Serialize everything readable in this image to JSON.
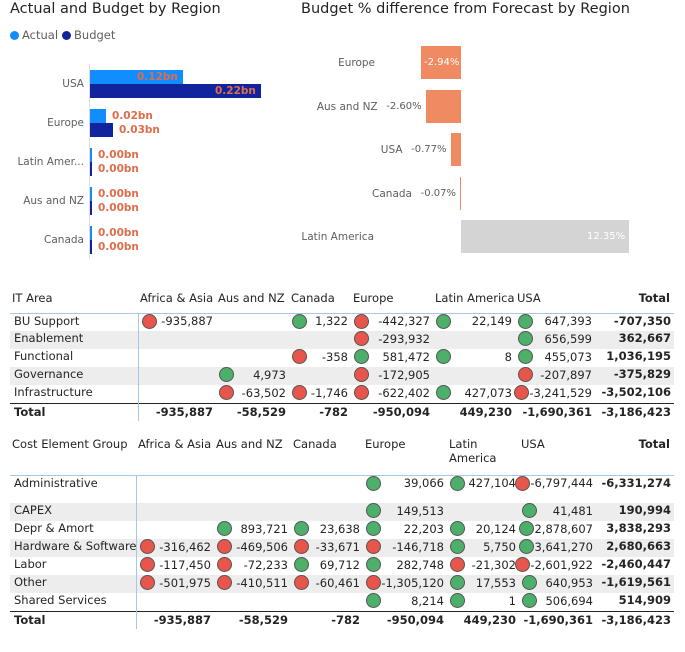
{
  "left_chart": {
    "title": "Actual and Budget by Region",
    "legend": [
      {
        "label": "Actual",
        "color": "#118dff"
      },
      {
        "label": "Budget",
        "color": "#12239e"
      }
    ],
    "chart_data": {
      "type": "bar",
      "orientation": "horizontal",
      "categories": [
        "USA",
        "Europe",
        "Latin Amer...",
        "Aus and NZ",
        "Canada"
      ],
      "series": [
        {
          "name": "Actual",
          "values": [
            0.12,
            0.02,
            0.0,
            0.0,
            0.0
          ],
          "labels": [
            "0.12bn",
            "0.02bn",
            "0.00bn",
            "0.00bn",
            "0.00bn"
          ]
        },
        {
          "name": "Budget",
          "values": [
            0.22,
            0.03,
            0.0,
            0.0,
            0.0
          ],
          "labels": [
            "0.22bn",
            "0.03bn",
            "0.00bn",
            "0.00bn",
            "0.00bn"
          ]
        }
      ],
      "unit": "bn",
      "xlim": [
        0,
        0.22
      ]
    }
  },
  "right_chart": {
    "title": "Budget % difference from Forecast by Region",
    "chart_data": {
      "type": "bar",
      "orientation": "horizontal",
      "categories": [
        "Europe",
        "Aus and NZ",
        "USA",
        "Canada",
        "Latin America"
      ],
      "values": [
        -2.94,
        -2.6,
        -0.77,
        -0.07,
        12.35
      ],
      "labels": [
        "-2.94%",
        "-2.60%",
        "-0.77%",
        "-0.07%",
        "12.35%"
      ],
      "colors": {
        "negative": "#ef8a62",
        "positive": "#d4d4d4",
        "inside_label": "#ffffff",
        "outside_label": "#605e5c"
      }
    }
  },
  "it_table": {
    "headers": [
      "IT Area",
      "Africa & Asia",
      "Aus and NZ",
      "Canada",
      "Europe",
      "Latin America",
      "USA",
      "Total"
    ],
    "rows": [
      {
        "label": "BU Support",
        "cells": [
          [
            "r",
            "-935,887"
          ],
          [
            "",
            ""
          ],
          [
            "g",
            "1,322"
          ],
          [
            "r",
            "-442,327"
          ],
          [
            "g",
            "22,149"
          ],
          [
            "g",
            "647,393"
          ]
        ],
        "total": "-707,350"
      },
      {
        "label": "Enablement",
        "cells": [
          [
            "",
            ""
          ],
          [
            "",
            ""
          ],
          [
            "",
            ""
          ],
          [
            "r",
            "-293,932"
          ],
          [
            "",
            ""
          ],
          [
            "g",
            "656,599"
          ]
        ],
        "total": "362,667"
      },
      {
        "label": "Functional",
        "cells": [
          [
            "",
            ""
          ],
          [
            "",
            ""
          ],
          [
            "r",
            "-358"
          ],
          [
            "g",
            "581,472"
          ],
          [
            "g",
            "8"
          ],
          [
            "g",
            "455,073"
          ]
        ],
        "total": "1,036,195"
      },
      {
        "label": "Governance",
        "cells": [
          [
            "",
            ""
          ],
          [
            "g",
            "4,973"
          ],
          [
            "",
            ""
          ],
          [
            "r",
            "-172,905"
          ],
          [
            "",
            ""
          ],
          [
            "r",
            "-207,897"
          ]
        ],
        "total": "-375,829"
      },
      {
        "label": "Infrastructure",
        "cells": [
          [
            "",
            ""
          ],
          [
            "r",
            "-63,502"
          ],
          [
            "r",
            "-1,746"
          ],
          [
            "r",
            "-622,402"
          ],
          [
            "g",
            "427,073"
          ],
          [
            "r",
            "-3,241,529"
          ]
        ],
        "total": "-3,502,106"
      }
    ],
    "total_row": {
      "label": "Total",
      "values": [
        "-935,887",
        "-58,529",
        "-782",
        "-950,094",
        "449,230",
        "-1,690,361"
      ],
      "total": "-3,186,423"
    }
  },
  "cost_table": {
    "headers": [
      "Cost Element Group",
      "Africa & Asia",
      "Aus and NZ",
      "Canada",
      "Europe",
      "Latin America",
      "USA",
      "Total"
    ],
    "rows": [
      {
        "label": "Administrative",
        "cells": [
          [
            "",
            ""
          ],
          [
            "",
            ""
          ],
          [
            "",
            ""
          ],
          [
            "g",
            "39,066"
          ],
          [
            "g",
            "427,104"
          ],
          [
            "r",
            "-6,797,444"
          ]
        ],
        "total": "-6,331,274"
      },
      {
        "label": "CAPEX",
        "cells": [
          [
            "",
            ""
          ],
          [
            "",
            ""
          ],
          [
            "",
            ""
          ],
          [
            "g",
            "149,513"
          ],
          [
            "",
            ""
          ],
          [
            "g",
            "41,481"
          ]
        ],
        "total": "190,994"
      },
      {
        "label": "Depr & Amort",
        "cells": [
          [
            "",
            ""
          ],
          [
            "g",
            "893,721"
          ],
          [
            "g",
            "23,638"
          ],
          [
            "g",
            "22,203"
          ],
          [
            "g",
            "20,124"
          ],
          [
            "g",
            "2,878,607"
          ]
        ],
        "total": "3,838,293"
      },
      {
        "label": "Hardware & Software",
        "cells": [
          [
            "r",
            "-316,462"
          ],
          [
            "r",
            "-469,506"
          ],
          [
            "r",
            "-33,671"
          ],
          [
            "r",
            "-146,718"
          ],
          [
            "g",
            "5,750"
          ],
          [
            "g",
            "3,641,270"
          ]
        ],
        "total": "2,680,663"
      },
      {
        "label": "Labor",
        "cells": [
          [
            "r",
            "-117,450"
          ],
          [
            "r",
            "-72,233"
          ],
          [
            "g",
            "69,712"
          ],
          [
            "g",
            "282,748"
          ],
          [
            "r",
            "-21,302"
          ],
          [
            "r",
            "-2,601,922"
          ]
        ],
        "total": "-2,460,447"
      },
      {
        "label": "Other",
        "cells": [
          [
            "r",
            "-501,975"
          ],
          [
            "r",
            "-410,511"
          ],
          [
            "r",
            "-60,461"
          ],
          [
            "r",
            "-1,305,120"
          ],
          [
            "g",
            "17,553"
          ],
          [
            "g",
            "640,953"
          ]
        ],
        "total": "-1,619,561"
      },
      {
        "label": "Shared Services",
        "cells": [
          [
            "",
            ""
          ],
          [
            "",
            ""
          ],
          [
            "",
            ""
          ],
          [
            "g",
            "8,214"
          ],
          [
            "g",
            "1"
          ],
          [
            "g",
            "506,694"
          ]
        ],
        "total": "514,909"
      }
    ],
    "total_row": {
      "label": "Total",
      "values": [
        "-935,887",
        "-58,529",
        "-782",
        "-950,094",
        "449,230",
        "-1,690,361"
      ],
      "total": "-3,186,423"
    }
  }
}
